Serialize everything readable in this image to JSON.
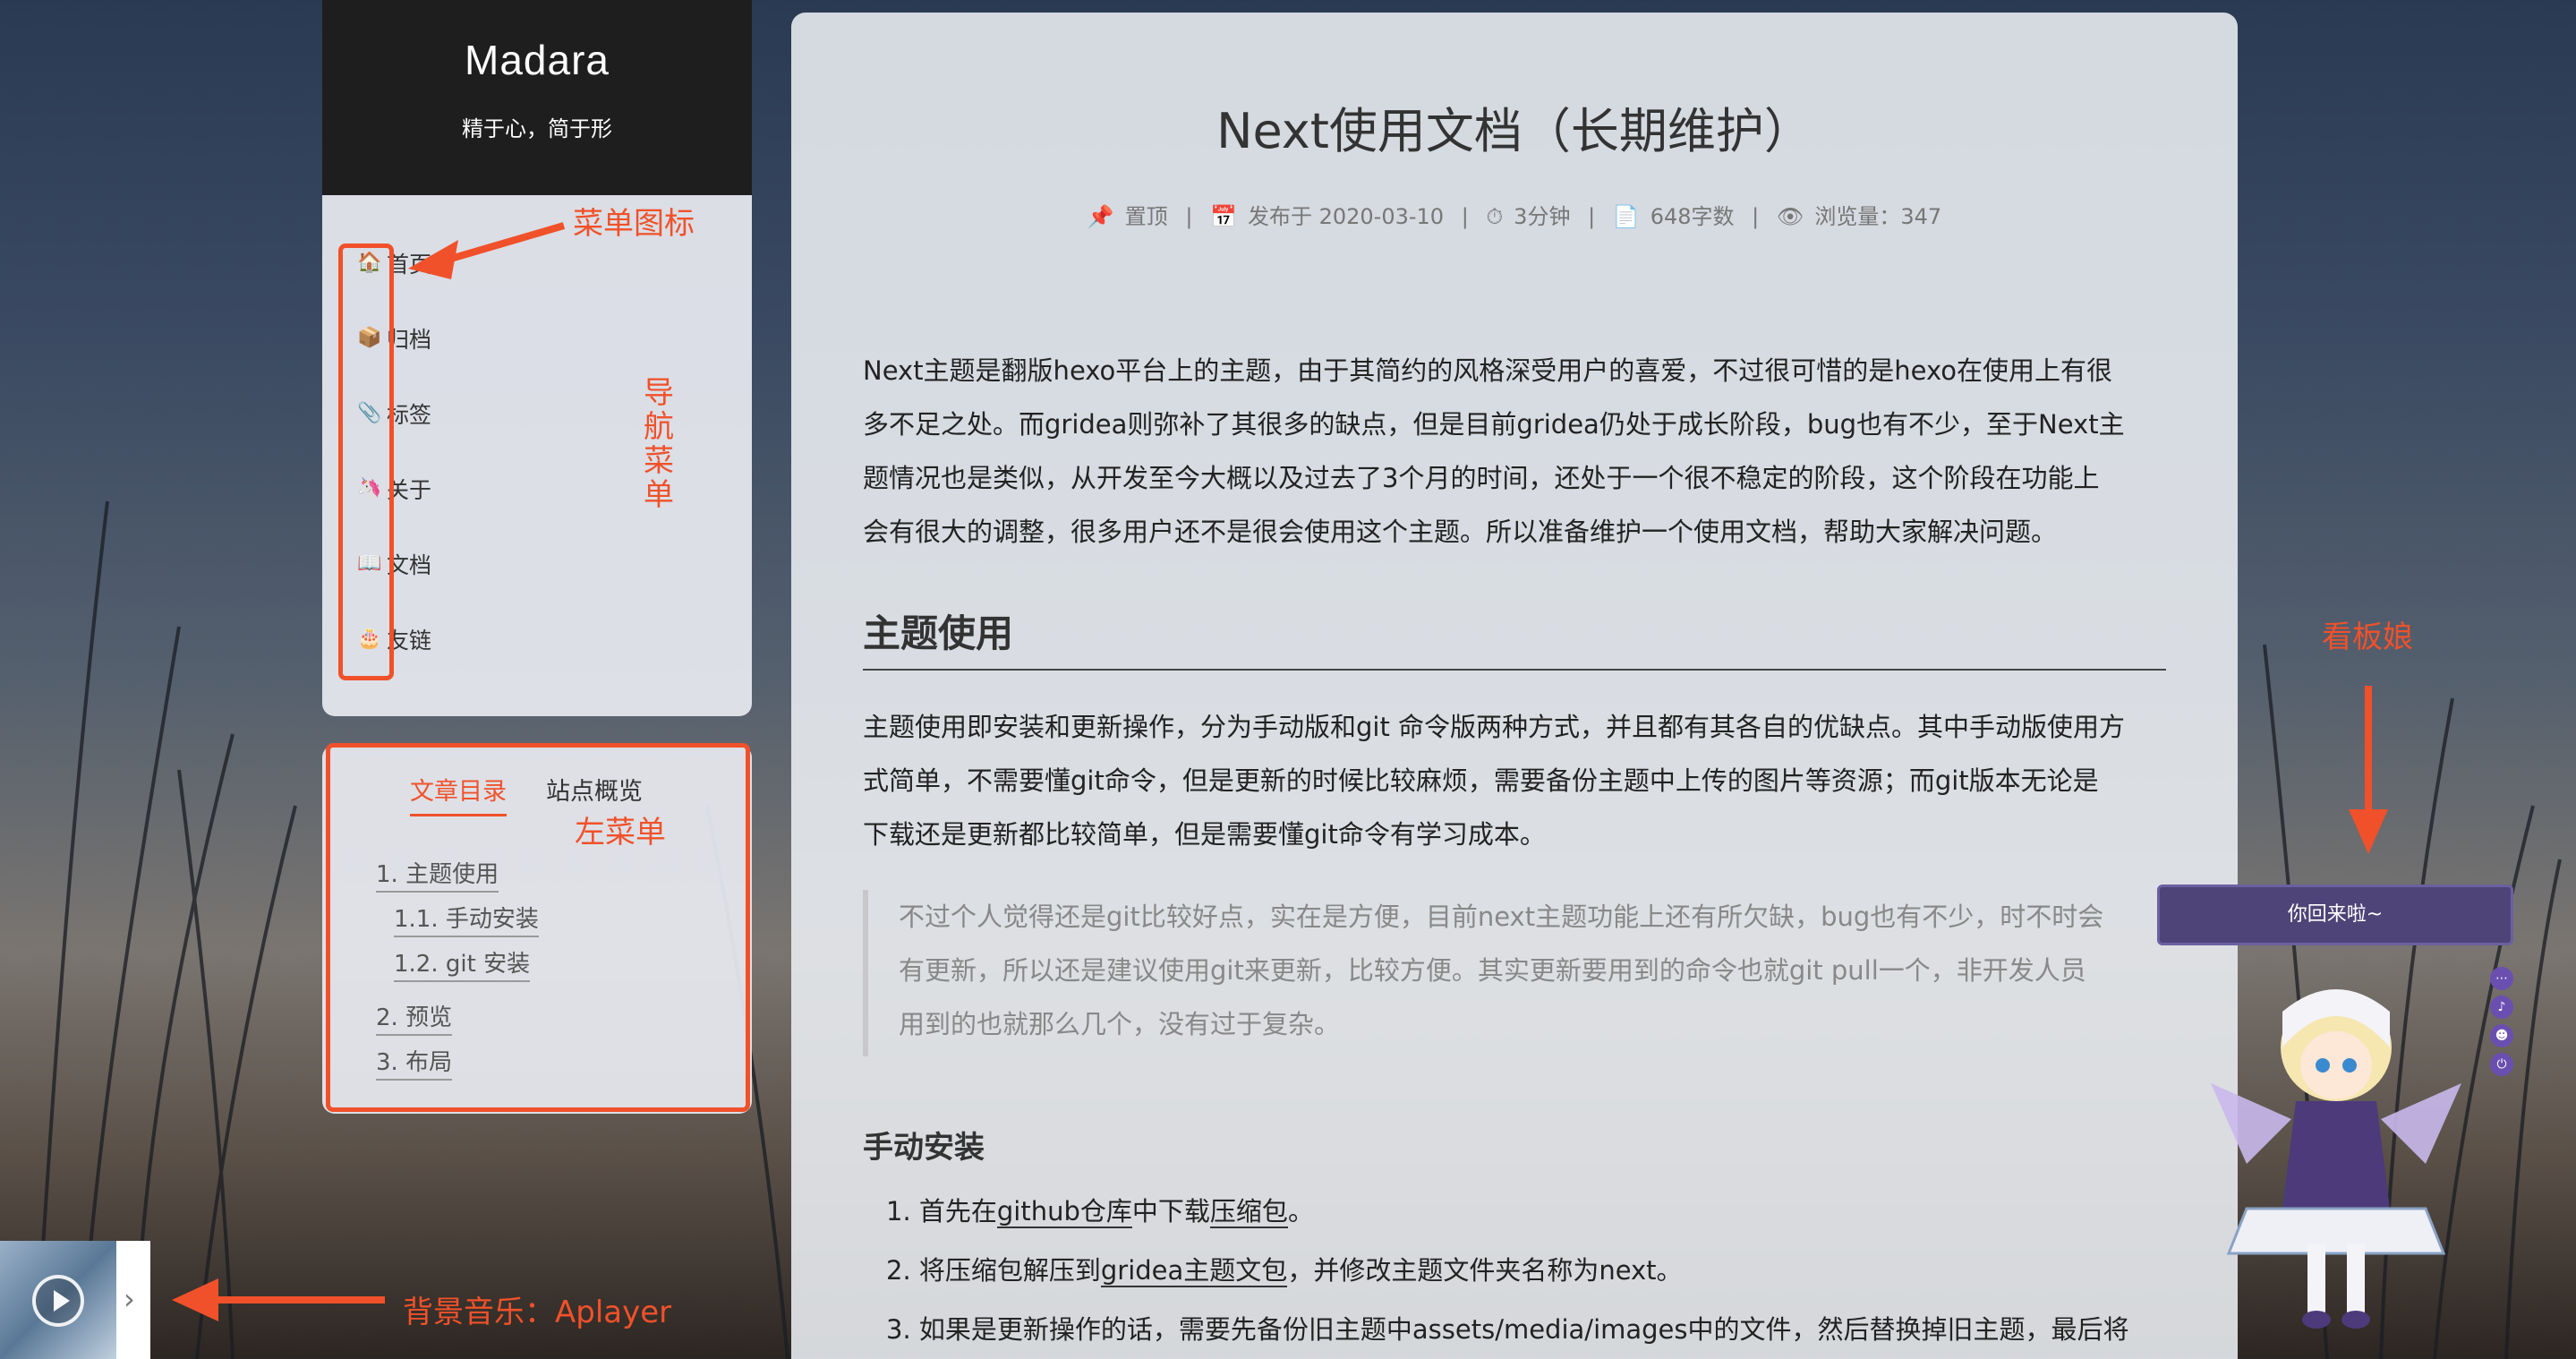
{
  "site": {
    "title": "Madara",
    "subtitle": "精于心，简于形"
  },
  "nav": {
    "items": [
      {
        "icon": "home-icon",
        "glyph": "🏠",
        "label": "首页"
      },
      {
        "icon": "archive-icon",
        "glyph": "📦",
        "label": "归档"
      },
      {
        "icon": "tag-icon",
        "glyph": "📎",
        "label": "标签"
      },
      {
        "icon": "about-icon",
        "glyph": "🦄",
        "label": "关于"
      },
      {
        "icon": "docs-icon",
        "glyph": "📖",
        "label": "文档"
      },
      {
        "icon": "links-icon",
        "glyph": "🎂",
        "label": "友链"
      }
    ]
  },
  "toc": {
    "tabs": [
      "文章目录",
      "站点概览"
    ],
    "active_tab": 0,
    "links": [
      {
        "text": "1. 主题使用",
        "level": 1
      },
      {
        "text": "1.1. 手动安装",
        "level": 2
      },
      {
        "text": "1.2. git 安装",
        "level": 2
      },
      {
        "text": "2. 预览",
        "level": 1
      },
      {
        "text": "3. 布局",
        "level": 1
      }
    ]
  },
  "post": {
    "title": "Next使用文档（长期维护）",
    "meta": {
      "pinned": "置顶",
      "published": "发布于 2020-03-10",
      "read_time": "3分钟",
      "word_count": "648字数",
      "views": "浏览量：347",
      "separator": "|"
    },
    "intro_lines": [
      "Next主题是翻版hexo平台上的主题，由于其简约的风格深受用户的喜爱，不过很可惜的是hexo在使用上有很",
      "多不足之处。而gridea则弥补了其很多的缺点，但是目前gridea仍处于成长阶段，bug也有不少，至于Next主",
      "题情况也是类似，从开发至今大概以及过去了3个月的时间，还处于一个很不稳定的阶段，这个阶段在功能上",
      "会有很大的调整，很多用户还不是很会使用这个主题。所以准备维护一个使用文档，帮助大家解决问题。"
    ],
    "section_heading": "主题使用",
    "section_lines": [
      "主题使用即安装和更新操作，分为手动版和git 命令版两种方式，并且都有其各自的优缺点。其中手动版使用方",
      "式简单，不需要懂git命令，但是更新的时候比较麻烦，需要备份主题中上传的图片等资源；而git版本无论是",
      "下载还是更新都比较简单，但是需要懂git命令有学习成本。"
    ],
    "quote_lines": [
      "不过个人觉得还是git比较好点，实在是方便，目前next主题功能上还有所欠缺，bug也有不少，时不时会",
      "有更新，所以还是建议使用git来更新，比较方便。其实更新要用到的命令也就git pull一个，非开发人员",
      "用到的也就那么几个，没有过于复杂。"
    ],
    "subheading": "手动安装",
    "steps": [
      {
        "prefix": "1. 首先在",
        "link1": "github仓库",
        "mid": "中下载",
        "link2": "压缩包",
        "suffix": "。"
      },
      {
        "prefix": "2. 将压缩包解压到",
        "link1": "gridea主题文包",
        "mid": "，并修改主题文件夹名称为next。",
        "link2": "",
        "suffix": ""
      },
      {
        "prefix": "3. 如果是更新操作的话，需要先备份旧主题中assets/media/images中的文件，然后替换掉旧主题，最后将",
        "link1": "",
        "mid": "",
        "link2": "",
        "suffix": ""
      }
    ]
  },
  "annotations": {
    "menu_icon": "菜单图标",
    "nav_menu": "导航菜单",
    "left_menu": "左菜单",
    "kanban": "看板娘",
    "bgm": "背景音乐：Aplayer"
  },
  "widget": {
    "message": "你回来啦~",
    "tools": [
      "more-icon",
      "music-icon",
      "face-icon",
      "power-icon"
    ],
    "tool_glyphs": [
      "⋯",
      "♪",
      "☻",
      "⏻"
    ]
  },
  "colors": {
    "accent": "#f0512a",
    "header_bg": "#1e1e1e",
    "widget_bg": "#4f4478"
  }
}
